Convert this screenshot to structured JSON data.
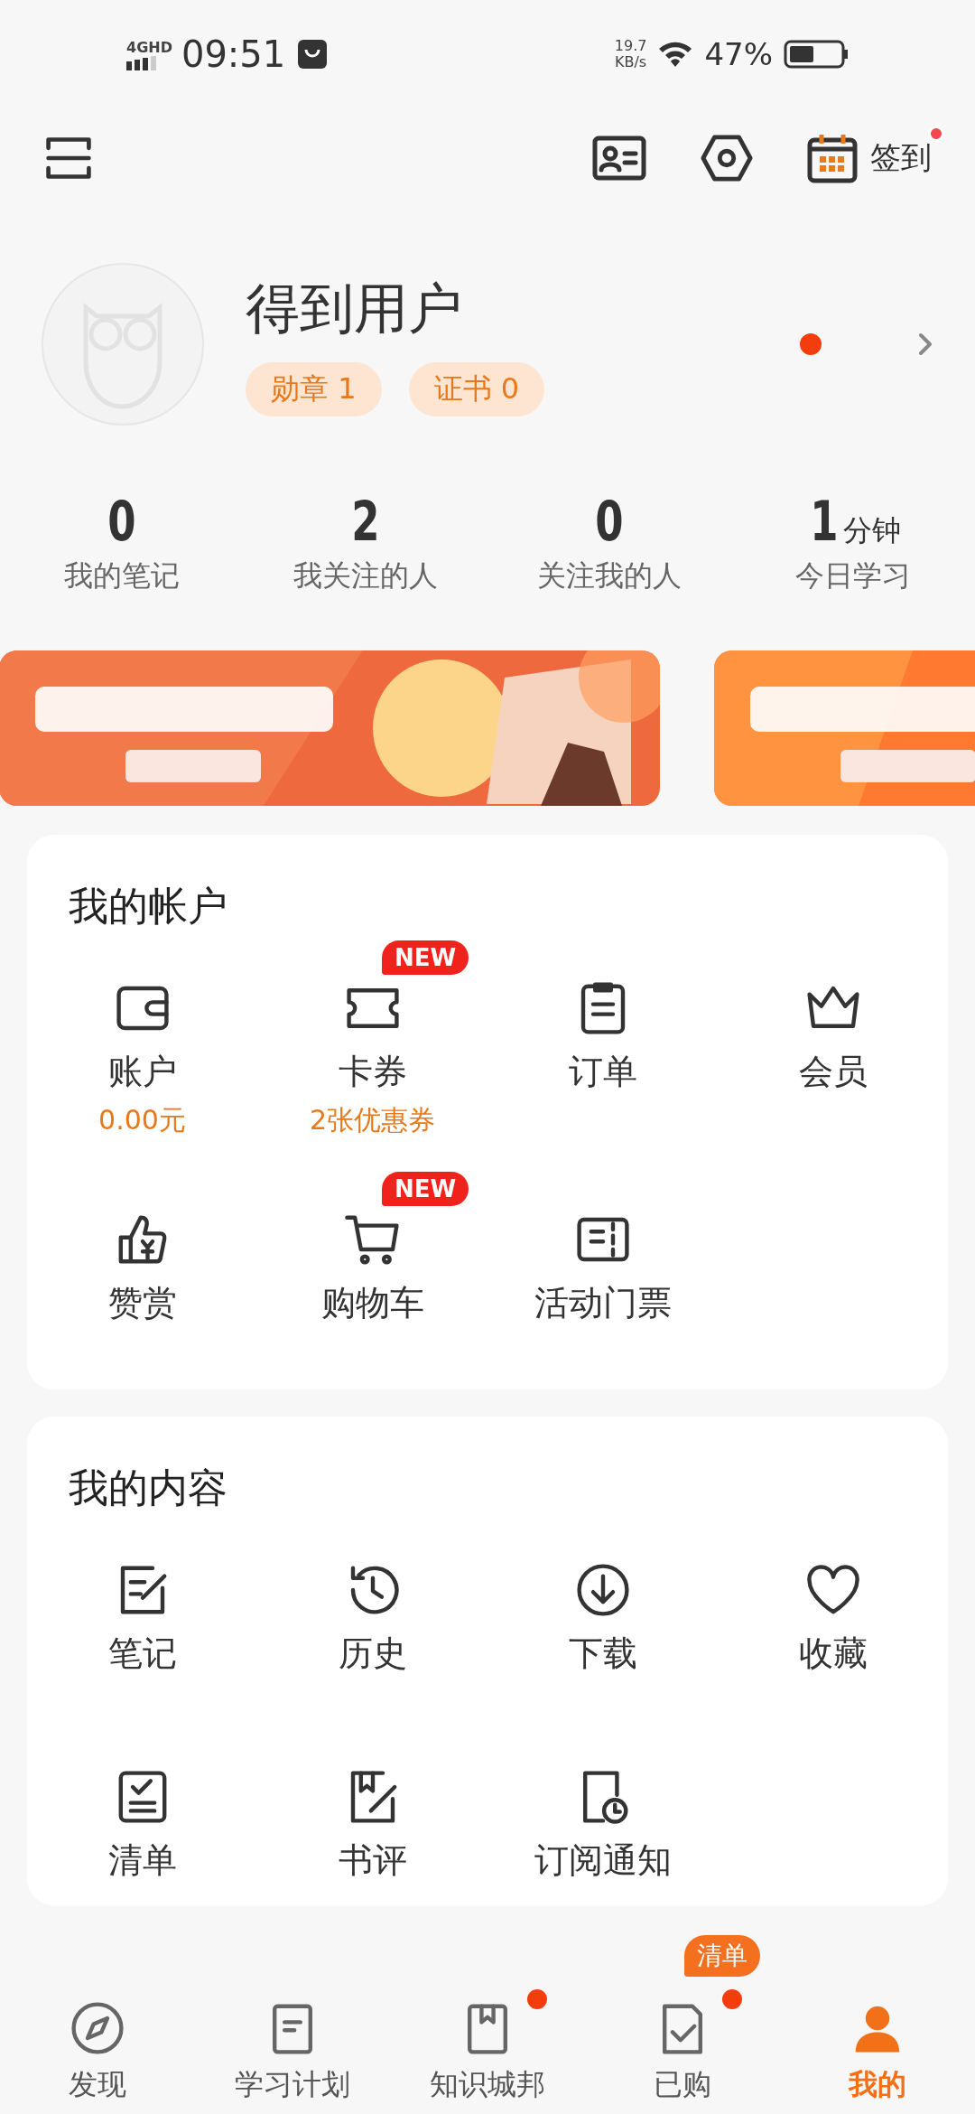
{
  "status_bar": {
    "network": "4GHD",
    "time": "09:51",
    "speed_value": "19.7",
    "speed_unit": "KB/s",
    "battery": "47%"
  },
  "toolbar": {
    "checkin_label": "签到",
    "checkin_dot": true
  },
  "profile": {
    "name": "得到用户",
    "notification_dot": true,
    "badges": [
      {
        "label": "勋章 1"
      },
      {
        "label": "证书 0"
      }
    ]
  },
  "stats": [
    {
      "value": "0",
      "label": "我的笔记"
    },
    {
      "value": "2",
      "label": "我关注的人"
    },
    {
      "value": "0",
      "label": "关注我的人"
    },
    {
      "value": "1",
      "unit": "分钟",
      "label": "今日学习"
    }
  ],
  "sections": [
    {
      "title": "我的帐户",
      "items": [
        {
          "label": "账户",
          "sub": "0.00元"
        },
        {
          "label": "卡券",
          "sub": "2张优惠券",
          "tag": "NEW"
        },
        {
          "label": "订单"
        },
        {
          "label": "会员"
        },
        {
          "label": "赞赏"
        },
        {
          "label": "购物车",
          "tag": "NEW"
        },
        {
          "label": "活动门票"
        }
      ]
    },
    {
      "title": "我的内容",
      "items": [
        {
          "label": "笔记"
        },
        {
          "label": "历史"
        },
        {
          "label": "下载"
        },
        {
          "label": "收藏"
        },
        {
          "label": "清单"
        },
        {
          "label": "书评"
        },
        {
          "label": "订阅通知"
        }
      ]
    }
  ],
  "nav": [
    {
      "label": "发现",
      "selected": false,
      "dot": false
    },
    {
      "label": "学习计划",
      "selected": false,
      "dot": false
    },
    {
      "label": "知识城邦",
      "selected": false,
      "dot": true
    },
    {
      "label": "已购",
      "selected": false,
      "dot": true,
      "bubble": "清单"
    },
    {
      "label": "我的",
      "selected": true,
      "dot": false
    }
  ]
}
